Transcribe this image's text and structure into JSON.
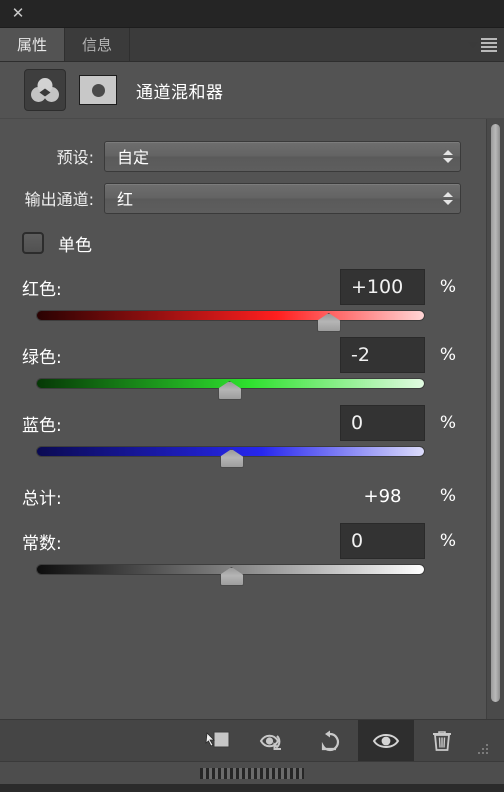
{
  "window": {
    "close_label": "✕"
  },
  "tabs": [
    {
      "label": "属性",
      "active": true
    },
    {
      "label": "信息",
      "active": false
    }
  ],
  "panel_menu": {
    "chevron_icon": "chevron-down-icon",
    "menu_icon": "panel-menu-icon"
  },
  "adjustment": {
    "icon": "channel-mixer-icon",
    "mask_icon": "layer-mask-thumbnail",
    "title": "通道混和器"
  },
  "fields": {
    "preset": {
      "label": "预设:",
      "value": "自定"
    },
    "output_channel": {
      "label": "输出通道:",
      "value": "红"
    },
    "monochrome": {
      "label": "单色",
      "checked": false
    }
  },
  "sliders": [
    {
      "name": "red",
      "label": "红色:",
      "value": "+100",
      "unit": "%",
      "thumb_pct": 75,
      "track": "red"
    },
    {
      "name": "green",
      "label": "绿色:",
      "value": "-2",
      "unit": "%",
      "thumb_pct": 49.5,
      "track": "green"
    },
    {
      "name": "blue",
      "label": "蓝色:",
      "value": "0",
      "unit": "%",
      "thumb_pct": 50,
      "track": "blue"
    }
  ],
  "total": {
    "label": "总计:",
    "value": "+98",
    "unit": "%"
  },
  "constant": {
    "label": "常数:",
    "value": "0",
    "unit": "%",
    "thumb_pct": 50,
    "track": "gray"
  },
  "toolbar": [
    {
      "icon": "clip-to-layer-icon",
      "active": false
    },
    {
      "icon": "view-previous-state-icon",
      "active": false
    },
    {
      "icon": "reset-icon",
      "active": false
    },
    {
      "icon": "toggle-layer-visibility-icon",
      "active": true
    },
    {
      "icon": "delete-layer-icon",
      "active": false
    }
  ],
  "colors": {
    "panel_bg": "#535353",
    "tab_bg": "#3b3b3b",
    "toolbar_bg": "#454545",
    "input_bg": "#333333",
    "text": "#ffffff"
  }
}
